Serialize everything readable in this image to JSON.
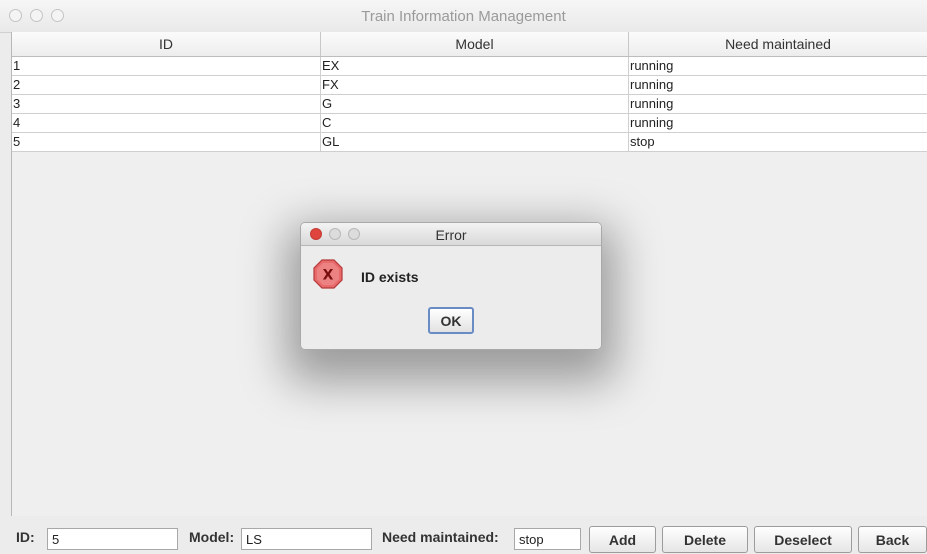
{
  "window": {
    "title": "Train Information Management"
  },
  "table": {
    "columns": [
      "ID",
      "Model",
      "Need maintained"
    ],
    "rows": [
      [
        "1",
        "EX",
        "running"
      ],
      [
        "2",
        "FX",
        "running"
      ],
      [
        "3",
        "G",
        "running"
      ],
      [
        "4",
        "C",
        "running"
      ],
      [
        "5",
        "GL",
        "stop"
      ]
    ]
  },
  "form": {
    "id_label": "ID:",
    "id_value": "5",
    "model_label": "Model:",
    "model_value": "LS",
    "need_label": "Need maintained:",
    "need_value": "stop",
    "buttons": {
      "add": "Add",
      "delete": "Delete",
      "deselect": "Deselect",
      "back": "Back"
    }
  },
  "dialog": {
    "title": "Error",
    "icon_text": "X",
    "message": "ID exists",
    "ok_label": "OK"
  },
  "colors": {
    "close_red": "#e0443e",
    "focus_blue": "#6a8cc4",
    "error_icon": "#e86a6a"
  },
  "icons": {
    "error": "error-octagon-icon"
  }
}
